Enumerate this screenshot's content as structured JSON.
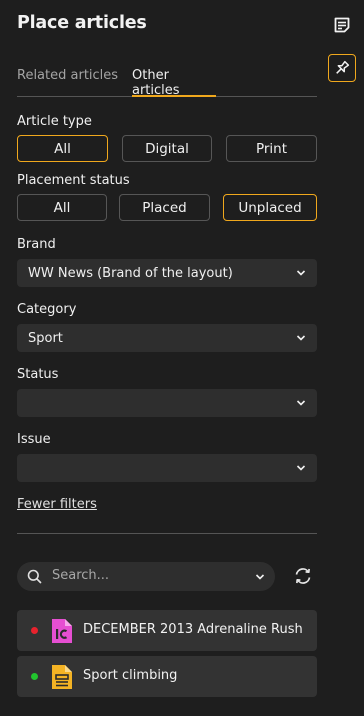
{
  "panel": {
    "title": "Place articles",
    "side_icons": [
      "notes-icon",
      "pin-icon"
    ]
  },
  "tabs": [
    {
      "label": "Related articles",
      "active": false
    },
    {
      "label": "Other articles",
      "active": true
    }
  ],
  "filters": {
    "article_type": {
      "label": "Article type",
      "options": [
        "All",
        "Digital",
        "Print"
      ],
      "selected": "All"
    },
    "placement_status": {
      "label": "Placement status",
      "options": [
        "All",
        "Placed",
        "Unplaced"
      ],
      "selected": "Unplaced"
    },
    "brand": {
      "label": "Brand",
      "value": "WW News (Brand of the layout)"
    },
    "category": {
      "label": "Category",
      "value": "Sport"
    },
    "status": {
      "label": "Status",
      "value": ""
    },
    "issue": {
      "label": "Issue",
      "value": ""
    },
    "fewer_filters_label": "Fewer filters"
  },
  "search": {
    "placeholder": "Search..."
  },
  "articles": [
    {
      "name": "DECEMBER 2013 Adrenaline Rush",
      "status_color": "#e8222d",
      "icon": "incopy-file-icon",
      "icon_color": "#e64fd2"
    },
    {
      "name": "Sport climbing",
      "status_color": "#22c52e",
      "icon": "article-file-icon",
      "icon_color": "#f4b324"
    }
  ],
  "colors": {
    "accent": "#f0a81d",
    "background": "#1e1e1e",
    "control": "#2e2e2e"
  }
}
